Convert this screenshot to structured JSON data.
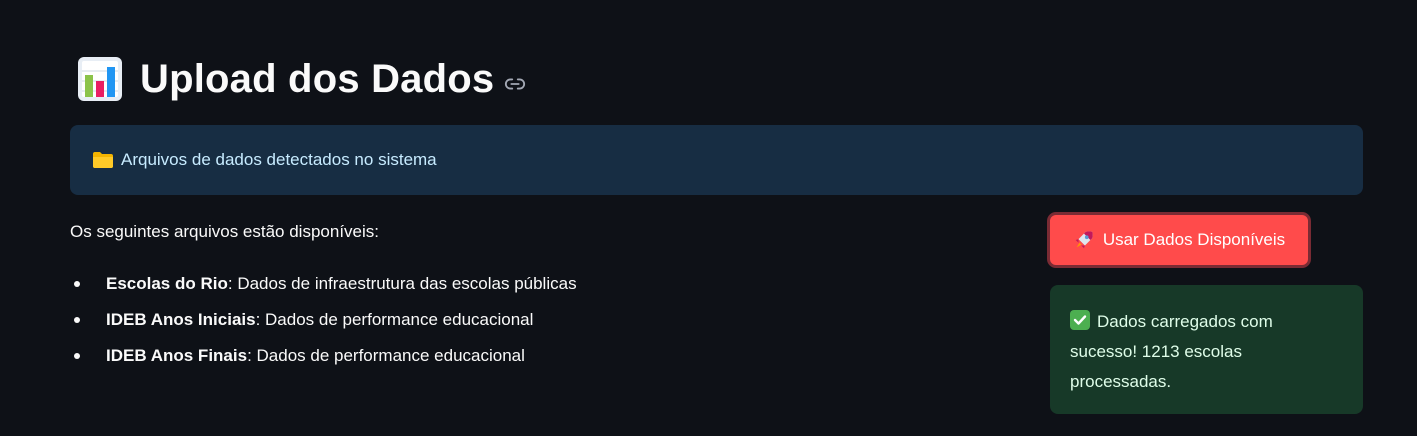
{
  "header": {
    "title": "Upload dos Dados",
    "icon": "bar-chart-icon",
    "link_icon": "link-icon"
  },
  "info": {
    "icon": "folder-icon",
    "text": "Arquivos de dados detectados no sistema"
  },
  "intro": "Os seguintes arquivos estão disponíveis:",
  "files": [
    {
      "name": "Escolas do Rio",
      "description": ": Dados de infraestrutura das escolas públicas"
    },
    {
      "name": "IDEB Anos Iniciais",
      "description": ": Dados de performance educacional"
    },
    {
      "name": "IDEB Anos Finais",
      "description": ": Dados de performance educacional"
    }
  ],
  "actions": {
    "use_data_label": "Usar Dados Disponíveis",
    "use_data_icon": "rocket-icon"
  },
  "success": {
    "icon": "check-icon",
    "text": "Dados carregados com sucesso! 1213 escolas processadas."
  },
  "colors": {
    "background": "#0e1117",
    "info_bg": "#172d43",
    "info_text": "#c7ebff",
    "primary_button": "#ff4b4b",
    "success_bg": "#173928",
    "success_text": "#dffde9"
  }
}
